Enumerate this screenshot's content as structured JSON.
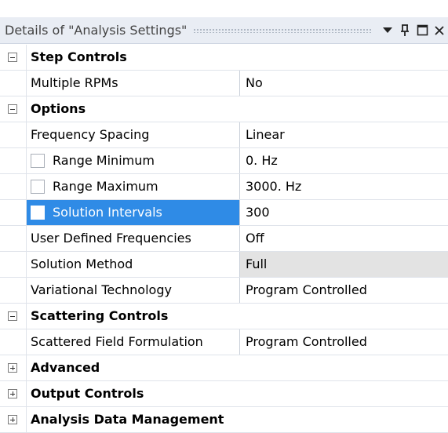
{
  "header": {
    "title": "Details of \"Analysis Settings\""
  },
  "groups": {
    "step_controls": {
      "label": "Step Controls",
      "rows": [
        {
          "name": "Multiple RPMs",
          "value": "No"
        }
      ]
    },
    "options": {
      "label": "Options",
      "rows": [
        {
          "name": "Frequency Spacing",
          "value": "Linear"
        },
        {
          "name": "Range Minimum",
          "value": "0. Hz"
        },
        {
          "name": "Range Maximum",
          "value": "3000. Hz"
        },
        {
          "name": "Solution Intervals",
          "value": "300"
        },
        {
          "name": "User Defined Frequencies",
          "value": "Off"
        },
        {
          "name": "Solution Method",
          "value": "Full"
        },
        {
          "name": "Variational Technology",
          "value": "Program Controlled"
        }
      ]
    },
    "scattering_controls": {
      "label": "Scattering Controls",
      "rows": [
        {
          "name": "Scattered Field Formulation",
          "value": "Program Controlled"
        }
      ]
    },
    "advanced": {
      "label": "Advanced"
    },
    "output_controls": {
      "label": "Output Controls"
    },
    "analysis_data_management": {
      "label": "Analysis Data Management"
    }
  },
  "colors": {
    "selection": "#2f8be6",
    "titlebar": "#e9edf4",
    "readonly_shade": "#e3e3e3"
  }
}
